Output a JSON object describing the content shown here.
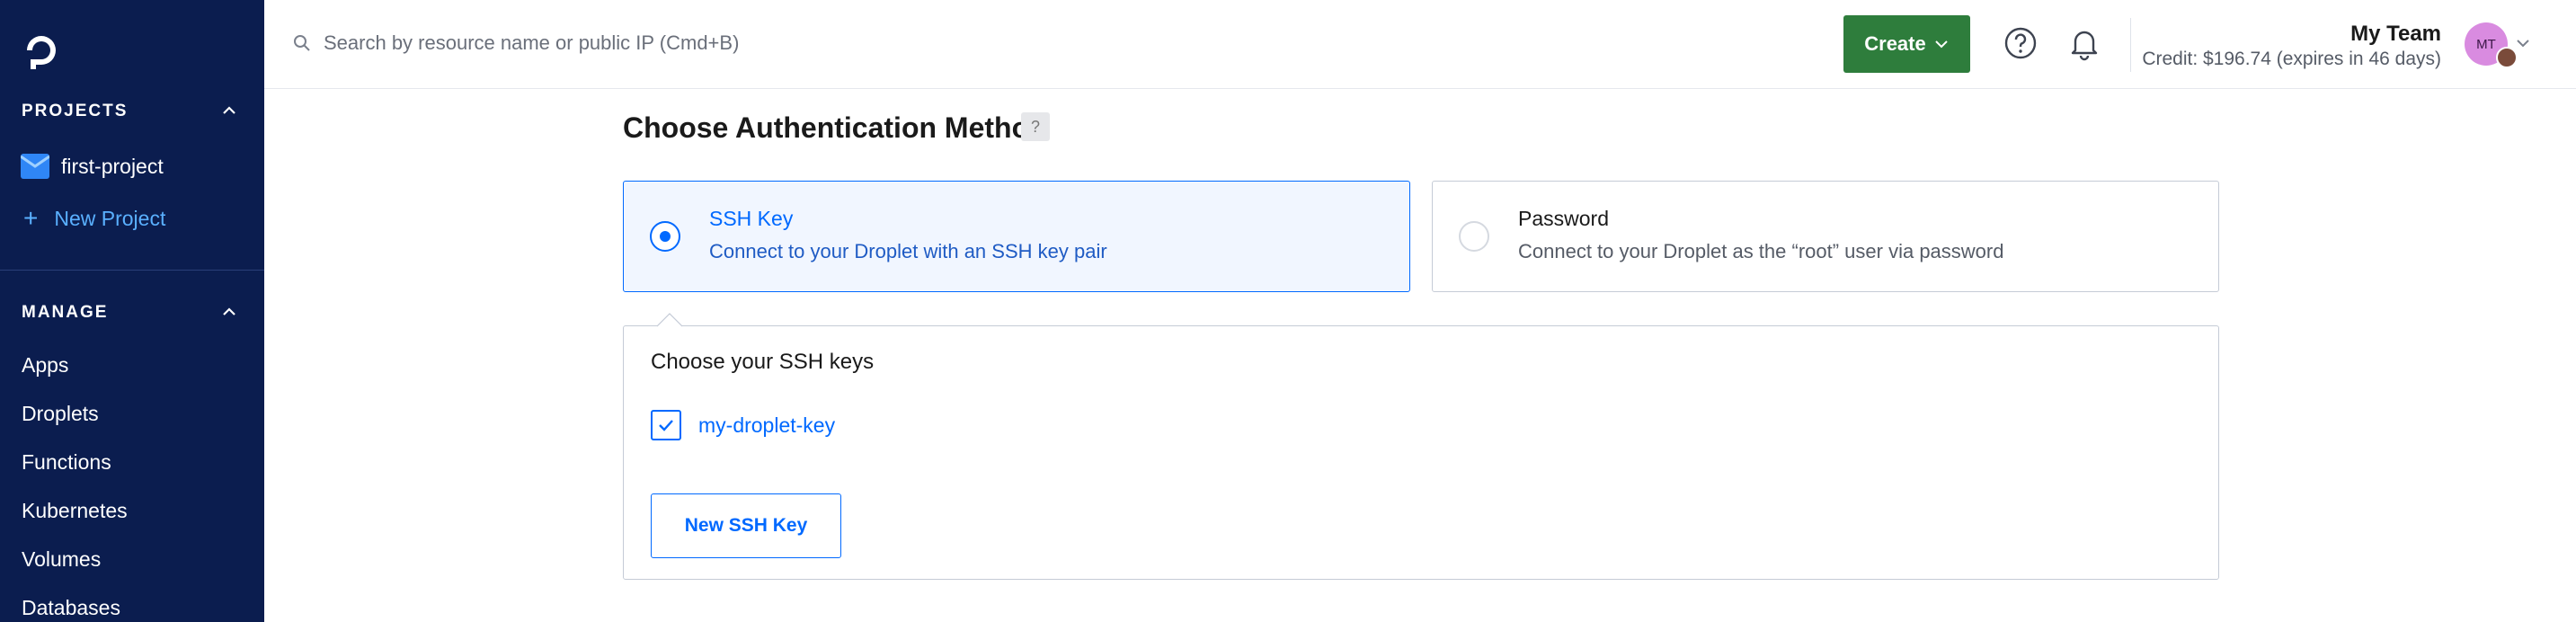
{
  "sidebar": {
    "projects_heading": "PROJECTS",
    "projects": [
      {
        "label": "first-project"
      }
    ],
    "new_project_label": "New Project",
    "manage_heading": "MANAGE",
    "manage_items": [
      {
        "label": "Apps"
      },
      {
        "label": "Droplets"
      },
      {
        "label": "Functions"
      },
      {
        "label": "Kubernetes"
      },
      {
        "label": "Volumes"
      },
      {
        "label": "Databases"
      }
    ]
  },
  "topbar": {
    "search_placeholder": "Search by resource name or public IP (Cmd+B)",
    "create_label": "Create",
    "team_name": "My Team",
    "credit_text": "Credit: $196.74 (expires in 46 days)",
    "avatar_initials": "MT"
  },
  "auth": {
    "title": "Choose Authentication Method",
    "help_label": "?",
    "options": [
      {
        "title": "SSH Key",
        "description": "Connect to your Droplet with an SSH key pair",
        "selected": true
      },
      {
        "title": "Password",
        "description": "Connect to your Droplet as the “root” user via password",
        "selected": false
      }
    ]
  },
  "ssh_keys": {
    "title": "Choose your SSH keys",
    "keys": [
      {
        "name": "my-droplet-key",
        "checked": true
      }
    ],
    "new_key_label": "New SSH Key"
  },
  "colors": {
    "sidebar_bg": "#0b1d4f",
    "accent_blue": "#0069ff",
    "create_green": "#2e7d3c",
    "new_project_link": "#5ab0ff"
  }
}
